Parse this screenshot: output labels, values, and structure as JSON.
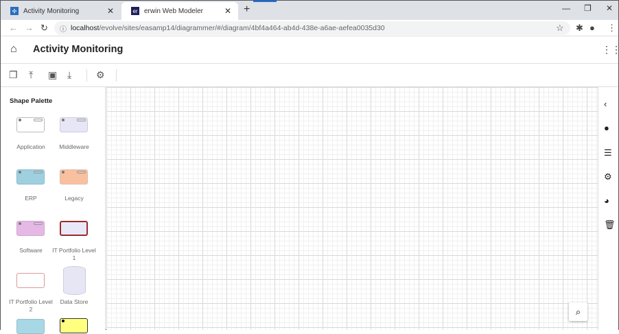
{
  "browser": {
    "tabs": [
      {
        "label": "Activity Monitoring",
        "icon": "app-favicon"
      },
      {
        "label": "erwin Web Modeler",
        "icon": "er",
        "active": true
      }
    ],
    "url_host": "localhost",
    "url_path": "/evolve/sites/easamp14/diagrammer/#/diagram/4bf4a464-ab4d-438e-a6ae-aefea0035d30"
  },
  "header": {
    "title": "Activity Monitoring"
  },
  "palette": {
    "title": "Shape Palette",
    "shapes": [
      {
        "label": "Application",
        "color": "#ffffff"
      },
      {
        "label": "Middleware",
        "color": "#e6e6f7"
      },
      {
        "label": "ERP",
        "color": "#9fd0e0"
      },
      {
        "label": "Legacy",
        "color": "#f9c0a0"
      },
      {
        "label": "Software",
        "color": "#e6b8e6"
      },
      {
        "label": "IT Portfolio Level 1",
        "color": "#e8e8f8"
      },
      {
        "label": "IT Portfolio Level 2",
        "color": "#ffffff"
      },
      {
        "label": "Data Store",
        "color": "#e6e6f5"
      }
    ]
  }
}
